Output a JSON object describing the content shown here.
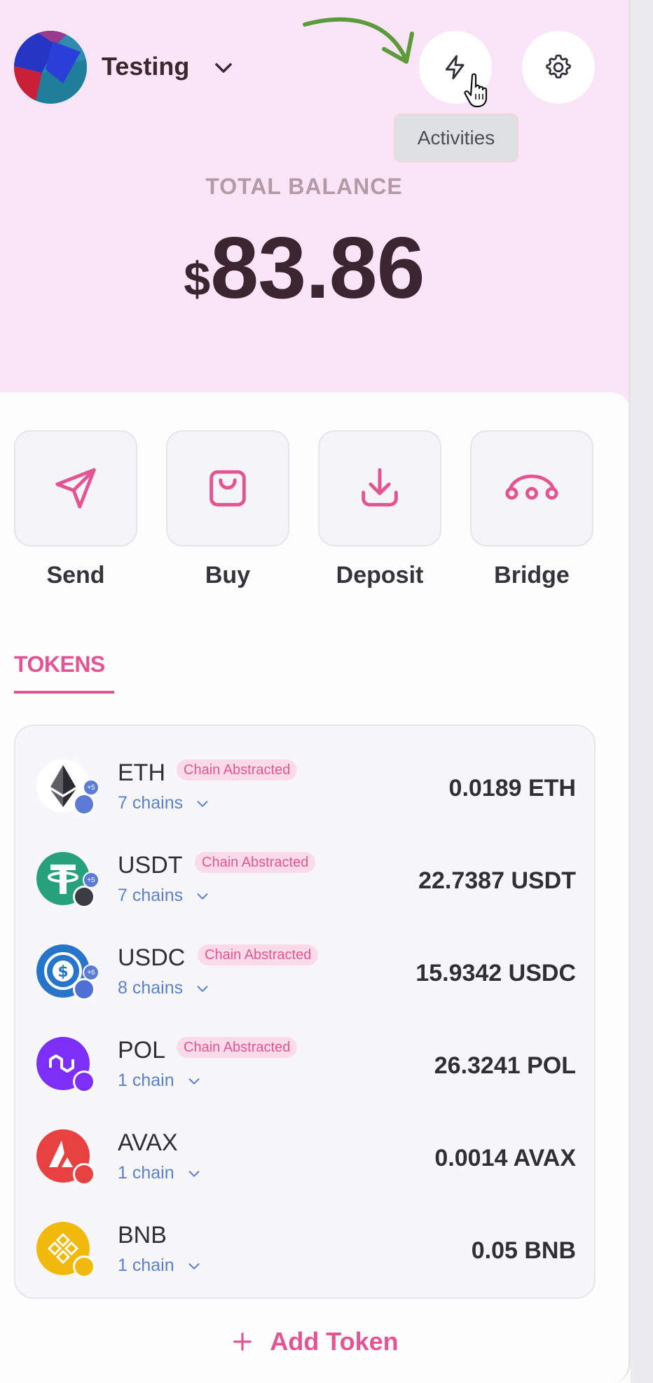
{
  "account": {
    "name": "Testing",
    "avatar_icon": "abstract-avatar",
    "dropdown_icon": "chevron-down-icon"
  },
  "header": {
    "activity_icon": "lightning-icon",
    "settings_icon": "gear-icon",
    "tooltip": "Activities"
  },
  "balance": {
    "label": "TOTAL BALANCE",
    "currency": "$",
    "amount": "83.86"
  },
  "actions": [
    {
      "label": "Send",
      "icon": "send-icon"
    },
    {
      "label": "Buy",
      "icon": "shopping-bag-icon"
    },
    {
      "label": "Deposit",
      "icon": "download-icon"
    },
    {
      "label": "Bridge",
      "icon": "bridge-icon"
    }
  ],
  "tabs": {
    "tokens": "TOKENS"
  },
  "tokens": [
    {
      "symbol": "ETH",
      "badge": "Chain Abstracted",
      "chains": "7 chains",
      "extra_chains": "+5",
      "amount": "0.0189 ETH",
      "color": "#f0f0f2"
    },
    {
      "symbol": "USDT",
      "badge": "Chain Abstracted",
      "chains": "7 chains",
      "extra_chains": "+5",
      "amount": "22.7387 USDT",
      "color": "#26a17b"
    },
    {
      "symbol": "USDC",
      "badge": "Chain Abstracted",
      "chains": "8 chains",
      "extra_chains": "+6",
      "amount": "15.9342 USDC",
      "color": "#2775ca"
    },
    {
      "symbol": "POL",
      "badge": "Chain Abstracted",
      "chains": "1 chain",
      "amount": "26.3241 POL",
      "color": "#7b2ff7"
    },
    {
      "symbol": "AVAX",
      "chains": "1 chain",
      "amount": "0.0014 AVAX",
      "color": "#e84142"
    },
    {
      "symbol": "BNB",
      "chains": "1 chain",
      "amount": "0.05 BNB",
      "color": "#f0b90b"
    }
  ],
  "add_token": {
    "label": "Add Token",
    "icon": "plus-icon"
  },
  "colors": {
    "accent": "#e35592",
    "hero_bg": "#f9e5f7",
    "link": "#5a7fd0"
  }
}
